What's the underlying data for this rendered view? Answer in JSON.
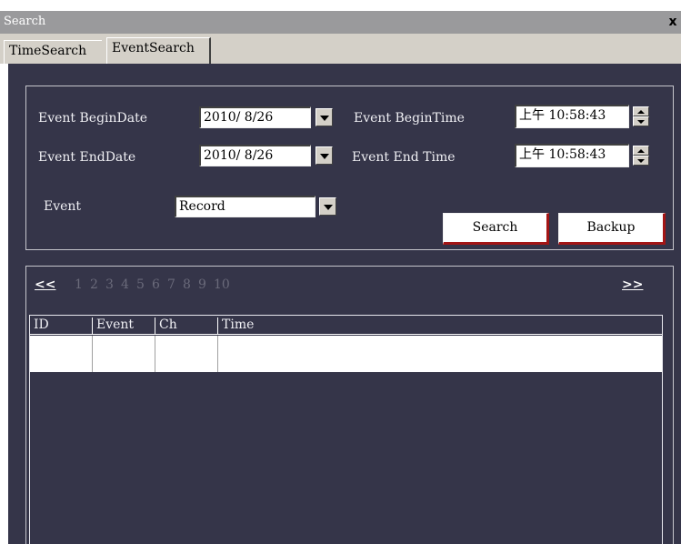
{
  "window": {
    "title": "Search",
    "close_glyph": "x"
  },
  "tabs": [
    {
      "label": "TimeSearch"
    },
    {
      "label": "EventSearch"
    }
  ],
  "form": {
    "begin_date_label": "Event BeginDate",
    "begin_date_value": "2010/ 8/26",
    "end_date_label": "Event EndDate",
    "end_date_value": "2010/ 8/26",
    "begin_time_label": "Event BeginTime",
    "begin_time_value": "上午 10:58:43",
    "end_time_label": "Event End Time",
    "end_time_value": "上午 10:58:43",
    "event_label": "Event",
    "event_value": "Record",
    "search_label": "Search",
    "backup_label": "Backup"
  },
  "pager": {
    "prev": "<<",
    "next": ">>",
    "pages": [
      "1",
      "2",
      "3",
      "4",
      "5",
      "6",
      "7",
      "8",
      "9",
      "10"
    ]
  },
  "table": {
    "columns": [
      "ID",
      "Event",
      "Ch",
      "Time"
    ]
  },
  "colors": {
    "panel_bg": "#353549",
    "button_shadow": "#a31515",
    "titlebar": "#9a9a9c"
  },
  "icons": [
    "close-icon",
    "dropdown-arrow-icon",
    "spin-up-icon",
    "spin-down-icon"
  ]
}
